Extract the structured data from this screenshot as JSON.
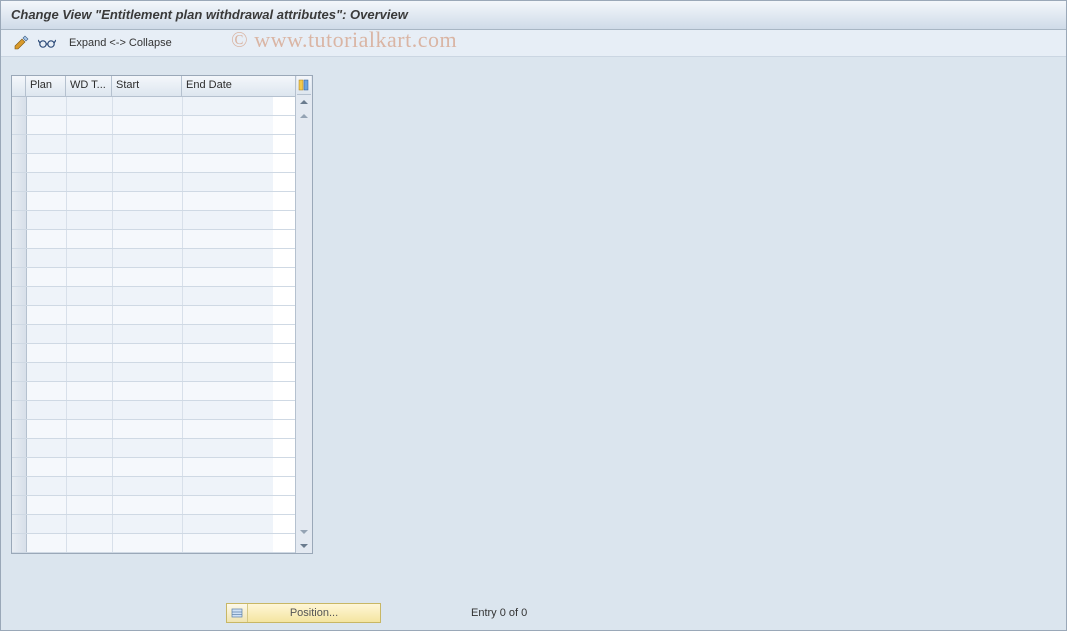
{
  "title": "Change View \"Entitlement plan withdrawal attributes\": Overview",
  "toolbar": {
    "expand_collapse": "Expand <-> Collapse"
  },
  "watermark": "© www.tutorialkart.com",
  "table": {
    "columns": {
      "plan": "Plan",
      "wd": "WD T...",
      "start": "Start",
      "end": "End Date"
    },
    "row_count": 24
  },
  "footer": {
    "position_label": "Position...",
    "entry_text": "Entry 0 of 0"
  }
}
